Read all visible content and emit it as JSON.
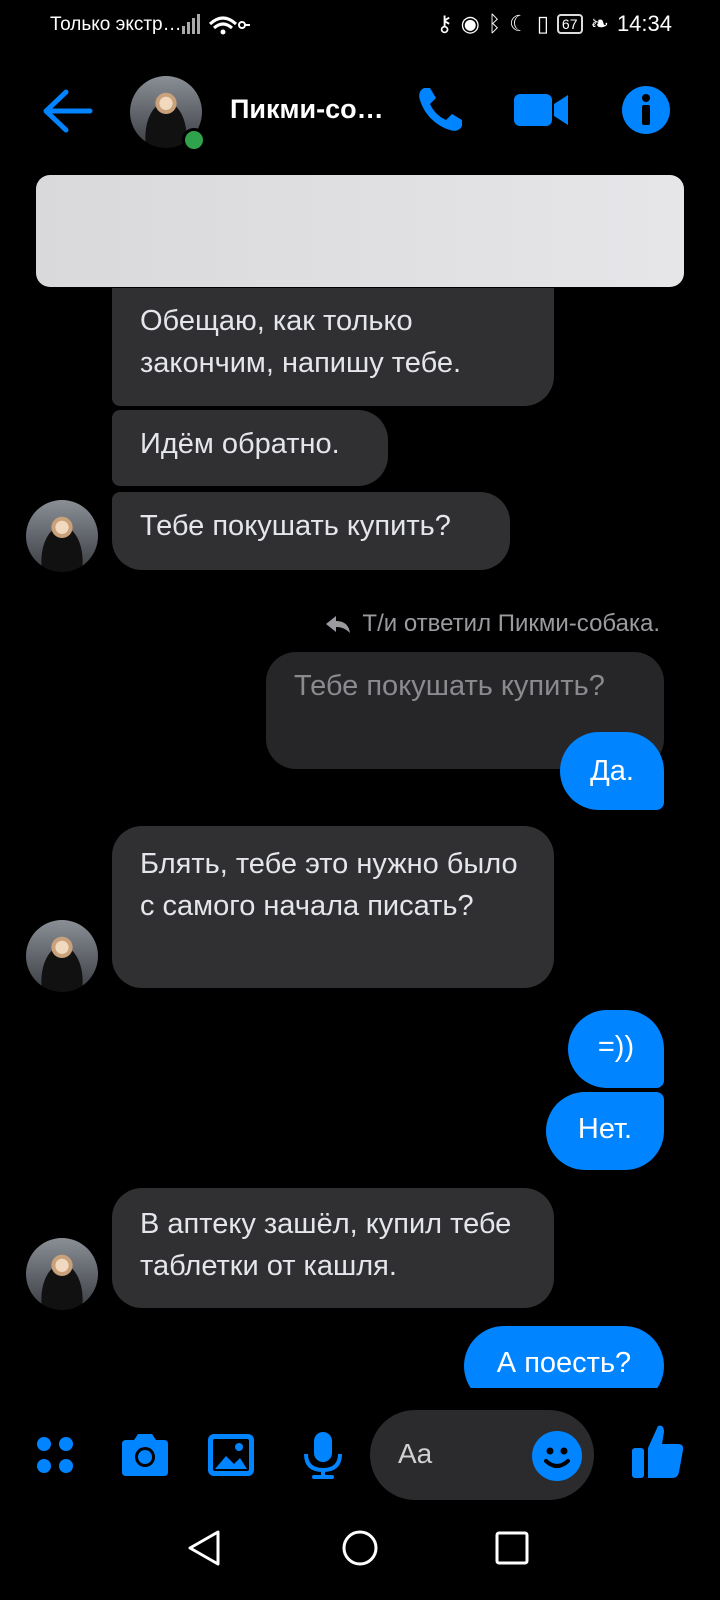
{
  "status": {
    "left_text": "Только экстр…",
    "time": "14:34",
    "battery": "67"
  },
  "header": {
    "title": "Пикми-со…"
  },
  "reply_note": "Т/и ответил Пикми-собака.",
  "messages": {
    "in1": "Обещаю, как только закончим, напишу тебе.",
    "in2": "Идём обратно.",
    "in3": "Тебе покушать купить?",
    "quoted": "Тебе покушать купить?",
    "out1": "Да.",
    "in4": "Блять, тебе это нужно было с самого начала писать?",
    "out2": "=))",
    "out3": "Нет.",
    "in5": "В аптеку зашёл, купил тебе таблетки от кашля.",
    "out4": "А поесть?"
  },
  "composer": {
    "placeholder": "Aa"
  },
  "colors": {
    "accent": "#0084ff",
    "incoming_bubble": "#303033",
    "online": "#31a24c"
  }
}
